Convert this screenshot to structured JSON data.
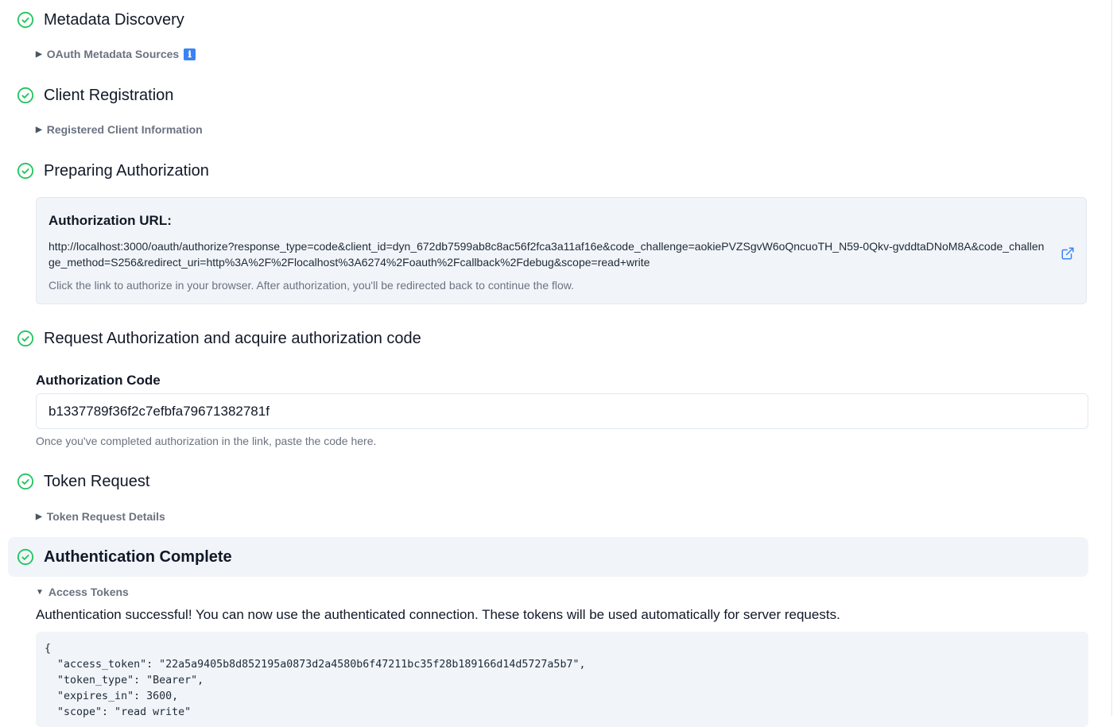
{
  "steps": [
    {
      "title": "Metadata Discovery"
    },
    {
      "title": "Client Registration"
    },
    {
      "title": "Preparing Authorization"
    },
    {
      "title": "Request Authorization and acquire authorization code"
    },
    {
      "title": "Token Request"
    },
    {
      "title": "Authentication Complete"
    }
  ],
  "metadata": {
    "disclosure_label": "OAuth Metadata Sources",
    "info_icon": "ℹ"
  },
  "registration": {
    "disclosure_label": "Registered Client Information"
  },
  "authorization": {
    "label": "Authorization URL:",
    "url": "http://localhost:3000/oauth/authorize?response_type=code&client_id=dyn_672db7599ab8c8ac56f2fca3a11af16e&code_challenge=aokiePVZSgvW6oQncuoTH_N59-0Qkv-gvddtaDNoM8A&code_challenge_method=S256&redirect_uri=http%3A%2F%2Flocalhost%3A6274%2Foauth%2Fcallback%2Fdebug&scope=read+write",
    "hint": "Click the link to authorize in your browser. After authorization, you'll be redirected back to continue the flow."
  },
  "auth_code": {
    "label": "Authorization Code",
    "value": "b1337789f36f2c7efbfa79671382781f",
    "help": "Once you've completed authorization in the link, paste the code here."
  },
  "token_request": {
    "disclosure_label": "Token Request Details"
  },
  "complete": {
    "disclosure_label": "Access Tokens",
    "message": "Authentication successful! You can now use the authenticated connection. These tokens will be used automatically for server requests.",
    "tokens_json": "{\n  \"access_token\": \"22a5a9405b8d852195a0873d2a4580b6f47211bc35f28b189166d14d5727a5b7\",\n  \"token_type\": \"Bearer\",\n  \"expires_in\": 3600,\n  \"scope\": \"read write\""
  },
  "colors": {
    "success": "#22c55e",
    "link": "#3b82f6",
    "muted": "#6b7280",
    "panel": "#f1f5f9"
  }
}
